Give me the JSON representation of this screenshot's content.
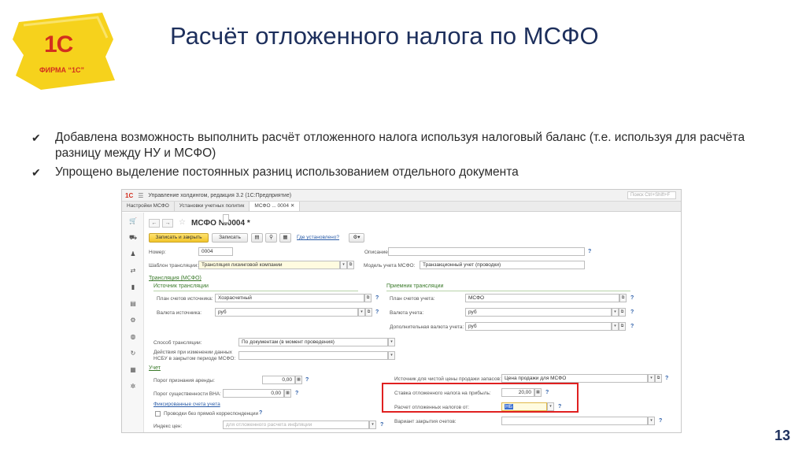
{
  "slide": {
    "title": "Расчёт отложенного налога по МСФО",
    "page_number": "13",
    "logo": {
      "main": "1С",
      "sub": "ФИРМА “1С”"
    },
    "bullets": [
      "Добавлена возможность выполнить расчёт отложенного налога используя налоговый баланс (т.е. используя для расчёта разницу между НУ и МСФО)",
      "Упрощено выделение постоянных разниц использованием отдельного документа"
    ]
  },
  "app": {
    "brand": "1С",
    "window_title": "Управление холдингом, редакция 3.2  (1С:Предприятие)",
    "search_placeholder": "Поиск Ctrl+Shift+F",
    "tabs": [
      "Настройки МСФО",
      "Установки учетных политик",
      "МСФО ... 0004"
    ],
    "doc_title": "МСФО №0004 *",
    "toolbar": {
      "save_close": "Записать и закрыть",
      "save": "Записать",
      "where_set": "Где установлено?"
    },
    "fields": {
      "number_label": "Номер:",
      "number_value": "0004",
      "description_label": "Описание:",
      "template_label": "Шаблон трансляции:",
      "template_value": "Трансляция лизинговой компании",
      "model_label": "Модель учета МСФО:",
      "model_value": "Транзакционный учет (проводки)",
      "translation_section": "Трансляция (МСФО)",
      "source_section": "Источник трансляции",
      "receiver_section": "Приемник трансляции",
      "source_plan_label": "План счетов источника:",
      "source_plan_value": "Хозрасчетный",
      "source_currency_label": "Валюта источника:",
      "source_currency_value": "руб",
      "acc_plan_label": "План счетов учета:",
      "acc_plan_value": "МСФО",
      "acc_currency_label": "Валюта учета:",
      "acc_currency_value": "руб",
      "add_currency_label": "Дополнительная валюта учета:",
      "add_currency_value": "руб",
      "method_label": "Способ трансляции:",
      "method_value": "По документам (в момент проведения)",
      "actions_label_1": "Действия при изменении данных",
      "actions_label_2": "НСБУ в закрытом периоде МСФО:",
      "accounting_section": "Учет",
      "lease_threshold_label": "Порог признания аренды:",
      "lease_threshold_value": "0,00",
      "materiality_label": "Порог существенности ВНА:",
      "materiality_value": "0,00",
      "fixed_accounts_link": "Фиксированные счета учета",
      "no_corr_label": "Проводки без прямой корреспонденции",
      "price_index_label": "Индекс цен:",
      "price_index_placeholder": "для отложенного расчета инфляции",
      "net_price_label": "Источник для чистой цены продажи запасов:",
      "net_price_value": "Цена продажи для МСФО",
      "deferred_rate_label": "Ставка отложенного налога на прибыль:",
      "deferred_rate_value": "20,00",
      "deferred_calc_label": "Расчет отложенных налогов от:",
      "deferred_calc_value": "НБ",
      "closing_variant_label": "Вариант закрытия счетов:"
    }
  }
}
